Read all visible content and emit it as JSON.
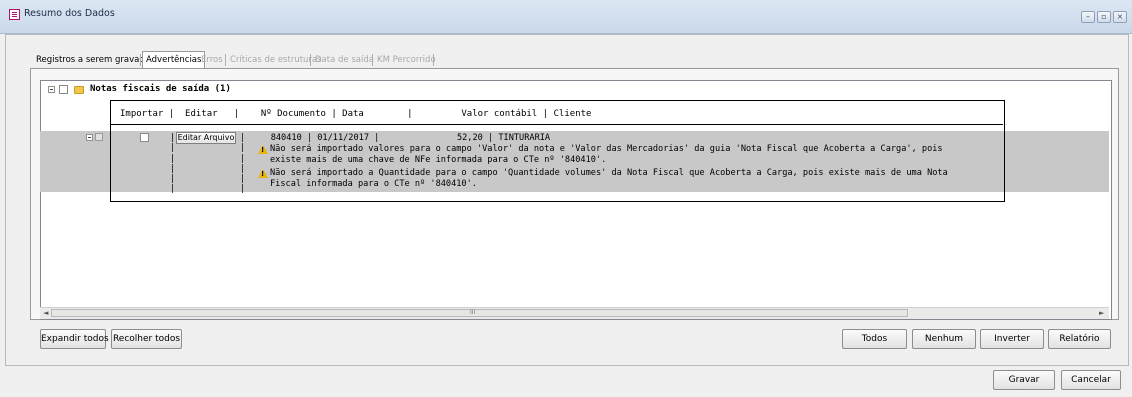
{
  "window": {
    "title": "Resumo dos Dados",
    "controls": [
      "minimize",
      "restore",
      "close"
    ]
  },
  "tabs": [
    {
      "label": "Registros a serem gravados",
      "state": "normal"
    },
    {
      "label": "Advertências",
      "state": "active"
    },
    {
      "label": "Erros",
      "state": "disabled"
    },
    {
      "label": "Críticas de estruturas",
      "state": "disabled"
    },
    {
      "label": "Data de saída",
      "state": "disabled"
    },
    {
      "label": "KM Percorrido",
      "state": "disabled"
    }
  ],
  "tree": {
    "node_label": "Notas fiscais de saída (1)",
    "header": "Importar |  Editar   |    Nº Documento | Data        |         Valor contábil | Cliente",
    "row": {
      "sep": "|",
      "edit_button": "Editar Arquivo",
      "main_line": "    840410 | 01/11/2017 |               52,20 | TINTURARIA",
      "warning1_line1": "Não será importado valores para o campo 'Valor' da nota e 'Valor das Mercadorias' da guia 'Nota Fiscal que Acoberta a Carga', pois",
      "warning1_line2": "existe mais de uma chave de NFe informada para o CTe nº '840410'.",
      "warning2_line1": "Não será importado a Quantidade para o campo 'Quantidade volumes' da Nota Fiscal que Acoberta a Carga, pois existe mais de uma Nota",
      "warning2_line2": "Fiscal informada para o CTe nº '840410'."
    }
  },
  "scrollbar": {
    "middle_glyph": "III"
  },
  "buttons": {
    "expand_all": "Expandir todos",
    "collapse_all": "Recolher todos",
    "all": "Todos",
    "none": "Nenhum",
    "invert": "Inverter",
    "report": "Relatório",
    "save": "Gravar",
    "cancel": "Cancelar"
  },
  "icons": {
    "app": "document-icon",
    "folder": "folder-icon",
    "warning": "warning-icon",
    "warning_color": "#e8b40e"
  },
  "colors": {
    "selected_row": "#c8c8c8",
    "titlebar": "#dde7f3"
  }
}
